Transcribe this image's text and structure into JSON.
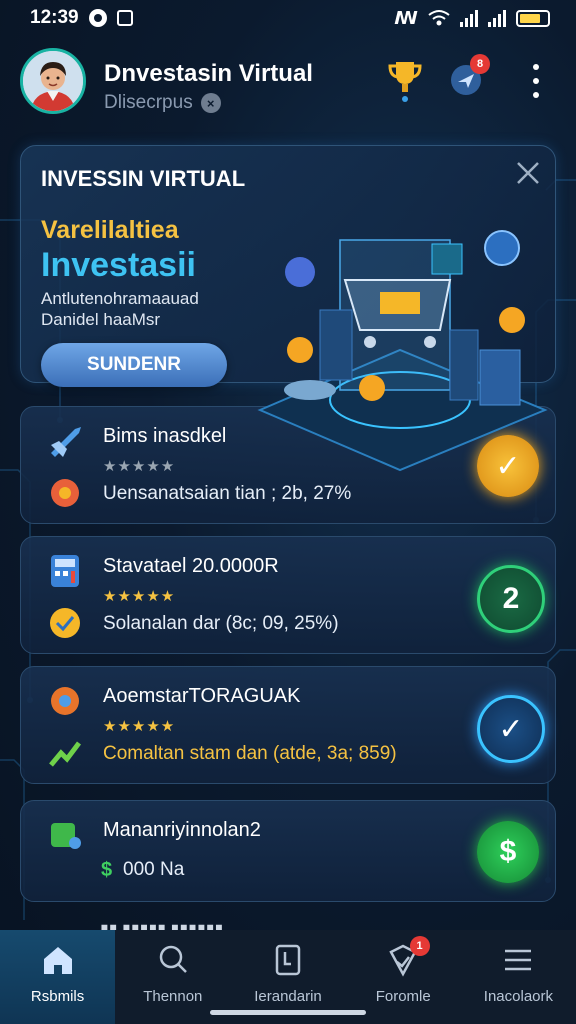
{
  "status_bar": {
    "time": "12:39"
  },
  "header": {
    "title": "Dnvestasin Virtual",
    "subtitle": "Dlisecrpus",
    "notification_count": "8"
  },
  "banner": {
    "heading": "INVESSIN VIRTUAL",
    "subheading": "Varelilaltiea",
    "main": "Investasii",
    "desc_line1": "Antlutenohramaauad",
    "desc_line2": "Danidel haaMsr",
    "button": "SUNDENR"
  },
  "cards": [
    {
      "title": "Bims inasdkel",
      "stars": "★★★★★",
      "desc": "Uensanatsaian tian ; 2b, 27%",
      "button": "✓",
      "accent": "#f2a81f"
    },
    {
      "title": "Stavatael 20.0000R",
      "stars": "★★★★★",
      "desc": "Solanalan dar (8c; 09, 25%)",
      "button": "2",
      "accent": "#1fa35a"
    },
    {
      "title": "AoemstarTORAGUAK",
      "stars": "★★★★★",
      "desc": "Comaltan stam dan (atde, 3a; 859)",
      "button": "✓",
      "accent": "#2c8ee6"
    },
    {
      "title": "Mananriyinnolan2",
      "stars": "",
      "desc": "000 Na",
      "button": "$",
      "accent": "#28b24b"
    }
  ],
  "nav": [
    {
      "label": "Rsbmils",
      "icon": "home-icon",
      "active": true
    },
    {
      "label": "Thennon",
      "icon": "search-icon",
      "active": false
    },
    {
      "label": "Ierandarin",
      "icon": "document-icon",
      "active": false
    },
    {
      "label": "Foromle",
      "icon": "chart-icon",
      "active": false,
      "badge": "1"
    },
    {
      "label": "Inacolaork",
      "icon": "menu-icon",
      "active": false
    }
  ]
}
